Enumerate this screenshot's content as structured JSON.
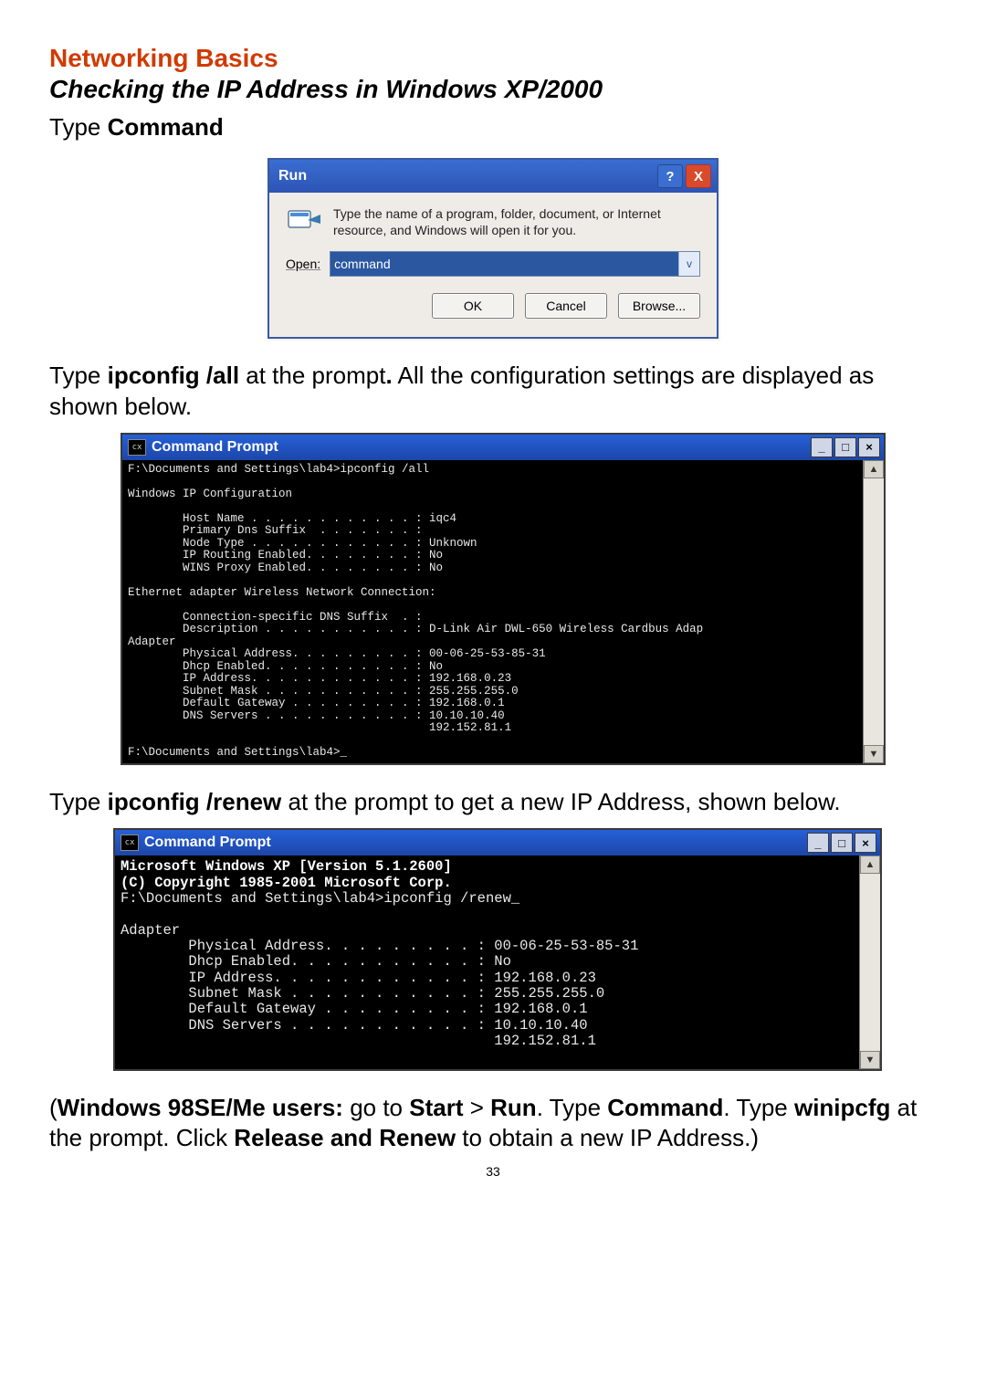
{
  "heading": {
    "section": "Networking  Basics",
    "subtitle": "Checking the IP Address in Windows XP/2000",
    "type_label": "Type ",
    "type_bold": "Command"
  },
  "run_dialog": {
    "title": "Run",
    "desc": "Type the name of a program, folder, document, or Internet resource, and Windows will open it for you.",
    "open_label": "Open:",
    "open_value": "command",
    "buttons": {
      "ok": "OK",
      "cancel": "Cancel",
      "browse": "Browse..."
    },
    "help_glyph": "?",
    "close_glyph": "X"
  },
  "para1": {
    "pre": "Type ",
    "bold": "ipconfig /all",
    "mid_bold_dot": ".",
    "post": " at the prompt",
    "tail": "  All the configuration settings are displayed as shown below."
  },
  "cmd1": {
    "title": "Command Prompt",
    "body": "F:\\Documents and Settings\\lab4>ipconfig /all\n\nWindows IP Configuration\n\n        Host Name . . . . . . . . . . . . : iqc4\n        Primary Dns Suffix  . . . . . . . :\n        Node Type . . . . . . . . . . . . : Unknown\n        IP Routing Enabled. . . . . . . . : No\n        WINS Proxy Enabled. . . . . . . . : No\n\nEthernet adapter Wireless Network Connection:\n\n        Connection-specific DNS Suffix  . :\n        Description . . . . . . . . . . . : D-Link Air DWL-650 Wireless Cardbus Adap\nAdapter\n        Physical Address. . . . . . . . . : 00-06-25-53-85-31\n        Dhcp Enabled. . . . . . . . . . . : No\n        IP Address. . . . . . . . . . . . : 192.168.0.23\n        Subnet Mask . . . . . . . . . . . : 255.255.255.0\n        Default Gateway . . . . . . . . . : 192.168.0.1\n        DNS Servers . . . . . . . . . . . : 10.10.10.40\n                                            192.152.81.1\n\nF:\\Documents and Settings\\lab4>_"
  },
  "para2": {
    "pre": "Type ",
    "bold": "ipconfig /renew",
    "post": " at the prompt to get a new IP Address, shown below."
  },
  "cmd2": {
    "title": "Command Prompt",
    "header_l1": "Microsoft Windows XP [Version 5.1.2600]",
    "header_l2": "(C) Copyright 1985-2001 Microsoft Corp.",
    "body": "\nF:\\Documents and Settings\\lab4>ipconfig /renew_\n\nAdapter\n        Physical Address. . . . . . . . . : 00-06-25-53-85-31\n        Dhcp Enabled. . . . . . . . . . . : No\n        IP Address. . . . . . . . . . . . : 192.168.0.23\n        Subnet Mask . . . . . . . . . . . : 255.255.255.0\n        Default Gateway . . . . . . . . . : 192.168.0.1\n        DNS Servers . . . . . . . . . . . : 10.10.10.40\n                                            192.152.81.1\n\n"
  },
  "para3": {
    "open": "(",
    "b1": "Windows 98SE/Me users:",
    "t1": "  go to ",
    "b2": "Start",
    "t2": " > ",
    "b3": "Run",
    "t3": ".  Type ",
    "b4": "Command",
    "t4": ".  Type ",
    "b5": "winipcfg",
    "t5": " at the prompt.  Click ",
    "b6": "Release and Renew",
    "t6": " to obtain a new IP Address.)"
  },
  "page_number": "33",
  "glyphs": {
    "min": "_",
    "max": "□",
    "close": "×",
    "up": "▲",
    "down": "▼",
    "dd": "v"
  }
}
